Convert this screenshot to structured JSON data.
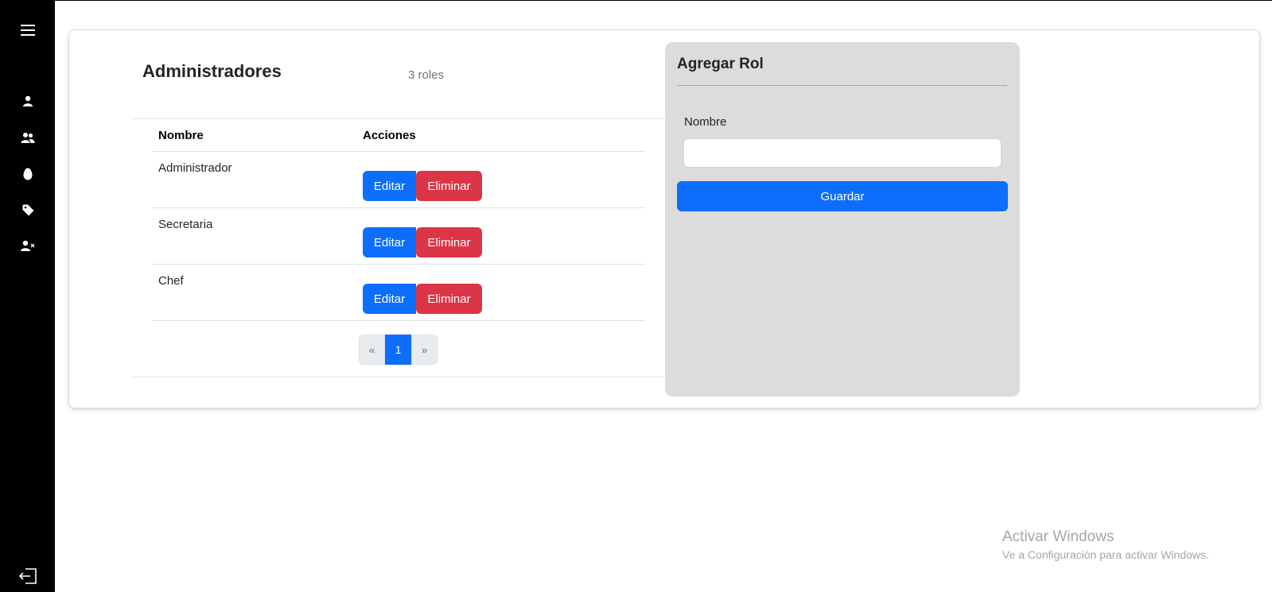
{
  "sidebar": {
    "items": [
      {
        "icon": "menu-icon"
      },
      {
        "icon": "user-icon"
      },
      {
        "icon": "users-icon"
      },
      {
        "icon": "egg-icon"
      },
      {
        "icon": "tag-icon"
      },
      {
        "icon": "user-x-icon"
      }
    ],
    "logout_icon": "logout-icon",
    "background": "#000000"
  },
  "header": {
    "title": "Administradores",
    "count": "3 roles"
  },
  "table": {
    "columns": [
      "Nombre",
      "Acciones"
    ],
    "rows": [
      {
        "name": "Administrador",
        "edit": "Editar",
        "delete": "Eliminar"
      },
      {
        "name": "Secretaria",
        "edit": "Editar",
        "delete": "Eliminar"
      },
      {
        "name": "Chef",
        "edit": "Editar",
        "delete": "Eliminar"
      }
    ]
  },
  "pagination": {
    "prev": "«",
    "current": "1",
    "next": "»"
  },
  "form": {
    "title": "Agregar Rol",
    "field_label": "Nombre",
    "field_value": "",
    "submit_label": "Guardar"
  },
  "watermark": {
    "title": "Activar Windows",
    "subtitle": "Ve a Configuración para activar Windows."
  },
  "colors": {
    "primary": "#0d6efd",
    "danger": "#dc3545",
    "panel_bg": "#dcdcdc"
  }
}
